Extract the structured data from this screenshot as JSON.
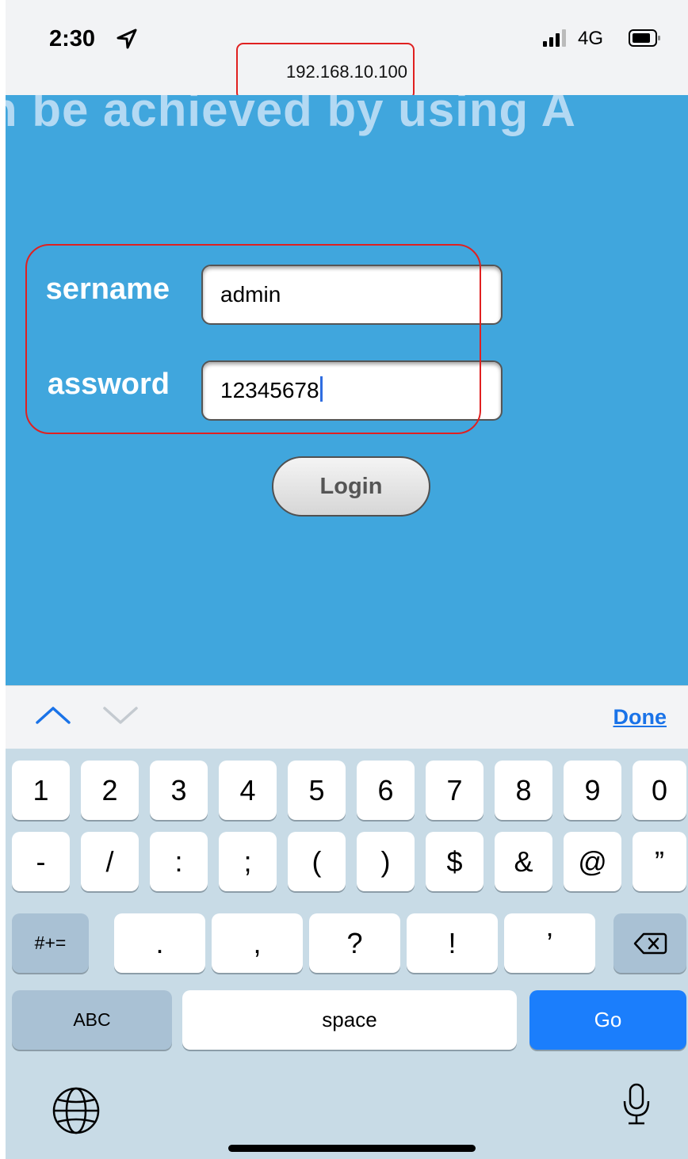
{
  "status_bar": {
    "time": "2:30",
    "network": "4G"
  },
  "browser": {
    "url": "192.168.10.100"
  },
  "page": {
    "banner_text": "n be achieved by using A",
    "username_label": "sername",
    "password_label": "assword",
    "username_value": "admin",
    "password_value": "12345678",
    "login_label": "Login",
    "background_color": "#40a6dd"
  },
  "accessory": {
    "done_label": "Done",
    "prev_icon": "chevron-up-icon",
    "next_icon": "chevron-down-icon"
  },
  "keyboard": {
    "row1": [
      "1",
      "2",
      "3",
      "4",
      "5",
      "6",
      "7",
      "8",
      "9",
      "0"
    ],
    "row2": [
      "-",
      "/",
      ":",
      ";",
      "(",
      ")",
      "$",
      "&",
      "@",
      "”"
    ],
    "row3": {
      "mode": "#+=",
      "keys": [
        ".",
        ",",
        "?",
        "!",
        "’"
      ],
      "backspace_icon": "backspace-icon"
    },
    "row4": {
      "abc": "ABC",
      "space": "space",
      "go": "Go"
    },
    "globe_icon": "globe-icon",
    "mic_icon": "microphone-icon",
    "go_color": "#1b7efc"
  }
}
